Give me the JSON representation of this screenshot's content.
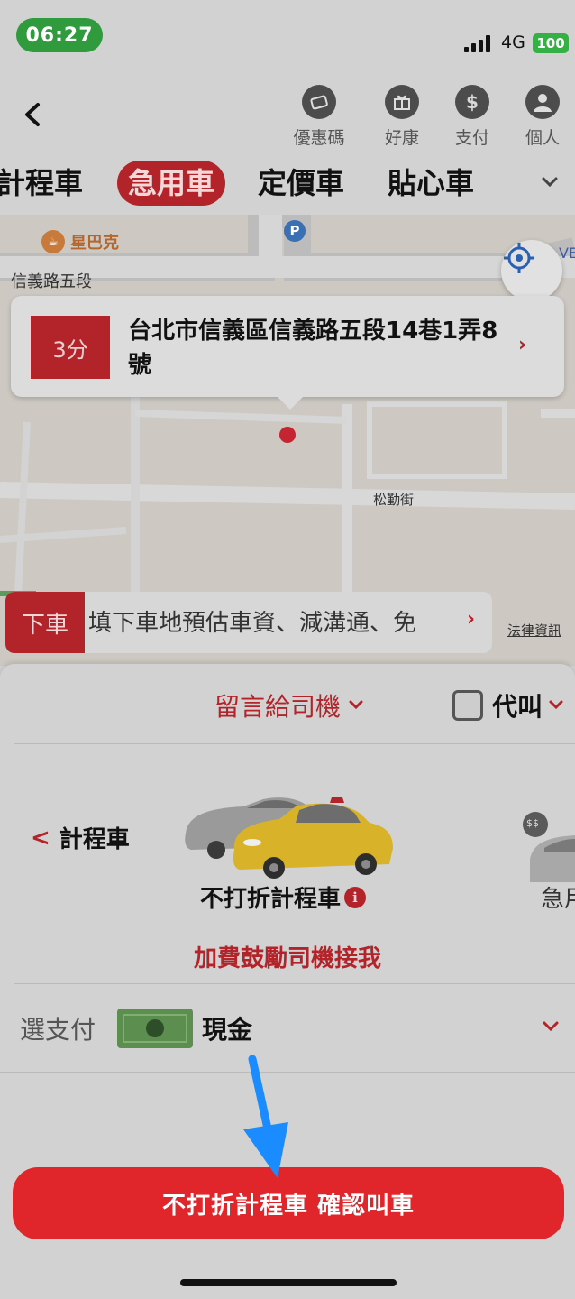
{
  "status_bar": {
    "time": "06:27",
    "network": "4G",
    "battery": "100"
  },
  "header": {
    "buttons": [
      {
        "label": "優惠碼",
        "icon": "coupon-icon"
      },
      {
        "label": "好康",
        "icon": "gift-icon"
      },
      {
        "label": "支付",
        "icon": "dollar-icon"
      },
      {
        "label": "個人",
        "icon": "profile-icon"
      }
    ],
    "dollar_glyph": "$"
  },
  "tabs": [
    {
      "label": "計程車",
      "active": false
    },
    {
      "label": "急用車",
      "active": true
    },
    {
      "label": "定價車",
      "active": false
    },
    {
      "label": "貼心車",
      "active": false
    }
  ],
  "map": {
    "poi_starbucks": "星巴克",
    "poi_starbucks_glyph": "☕",
    "parking_glyph": "P",
    "road_top": "信義路五段",
    "road_mid": "松勤街",
    "edge_label": "VE",
    "legal_link": "法律資訊"
  },
  "pickup": {
    "eta": "3分",
    "address": "台北市信義區信義路五段14巷1弄8號",
    "chevron": "›"
  },
  "dropoff": {
    "tag": "下車",
    "text": "填下車地預估車資、減溝通、免",
    "chevron": "›"
  },
  "sheet": {
    "note_driver": "留言給司機",
    "chev_down": "⌄",
    "proxy_label": "代叫",
    "prev_car": "計程車",
    "prev_glyph": "<",
    "car_name": "不打折計程車",
    "info_glyph": "i",
    "next_car_label": "急用",
    "next_car_badge": "$$",
    "boost": "加費鼓勵司機接我",
    "pay_label": "選支付",
    "pay_value": "現金",
    "confirm_button": "不打折計程車 確認叫車"
  },
  "colors": {
    "brand_red": "#e0262b",
    "dim_red": "#b3242a",
    "status_green": "#2f9b3c",
    "arrow_blue": "#1a8cff"
  }
}
